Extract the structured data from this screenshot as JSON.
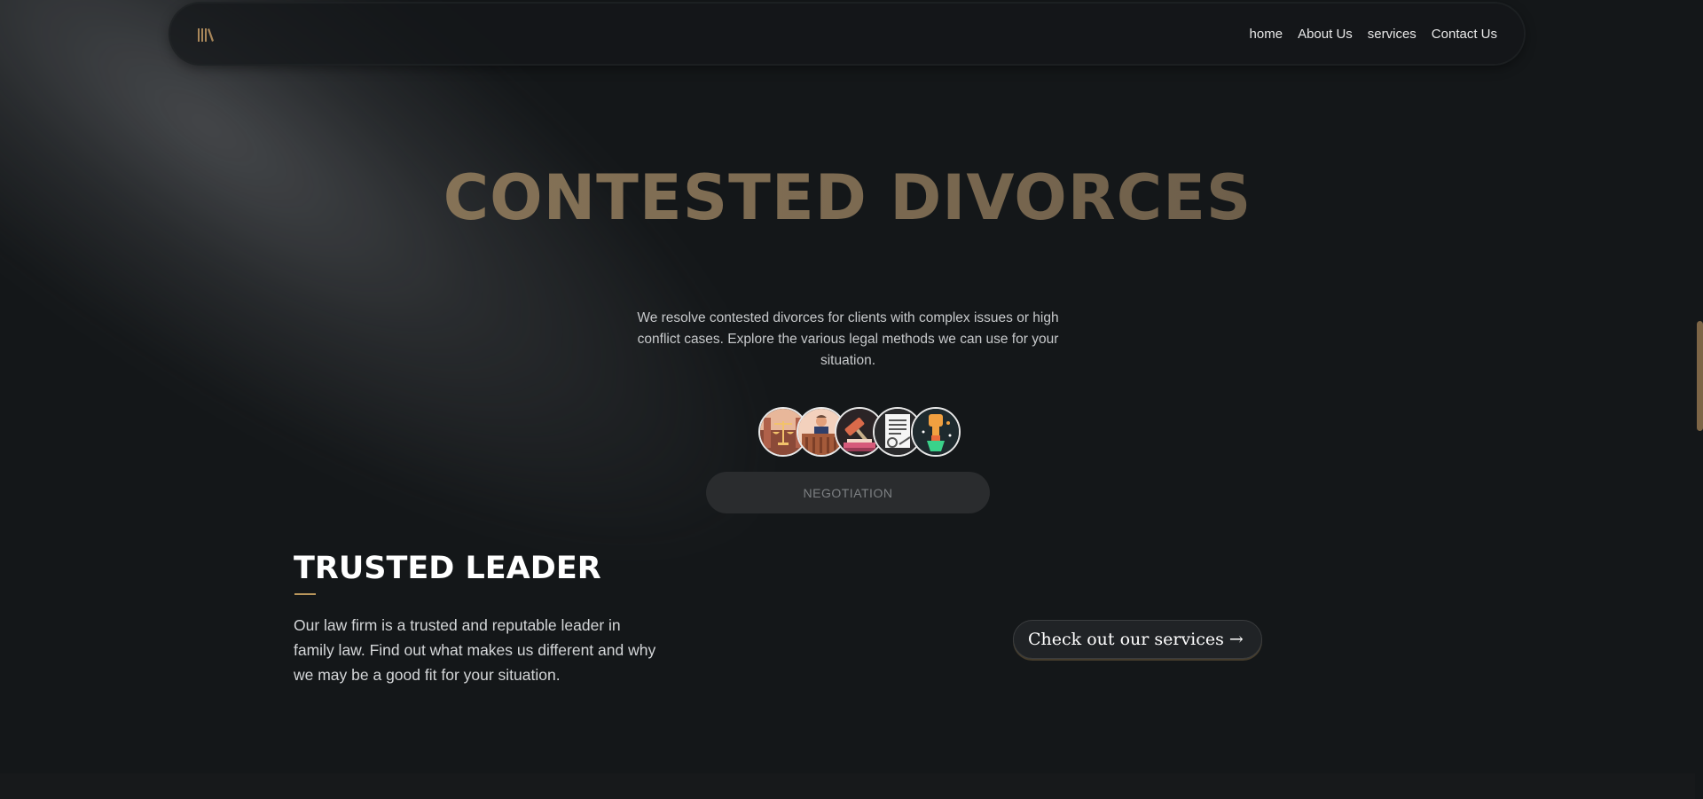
{
  "nav": {
    "logo_icon": "library-icon",
    "links": [
      "home",
      "About Us",
      "services",
      "Contact Us"
    ]
  },
  "hero": {
    "title": "CONTESTED DIVORCES",
    "description": "We resolve contested divorces for clients with complex issues or high conflict cases. Explore the various legal methods we can use for your situation.",
    "method_icons": [
      "scales-of-justice-icon",
      "judge-at-bench-icon",
      "gavel-icon",
      "legal-document-icon",
      "raised-fist-icon"
    ],
    "selected_method": "NEGOTIATION"
  },
  "leader": {
    "title": "TRUSTED LEADER",
    "text": "Our law firm is a trusted and reputable leader in family law. Find out what makes us different and why we may be a good fit for your situation.",
    "cta": "Check out our services →"
  },
  "colors": {
    "accent_gold": "#b9965b",
    "title_gold": "#8f7b5d",
    "background": "#141719"
  }
}
